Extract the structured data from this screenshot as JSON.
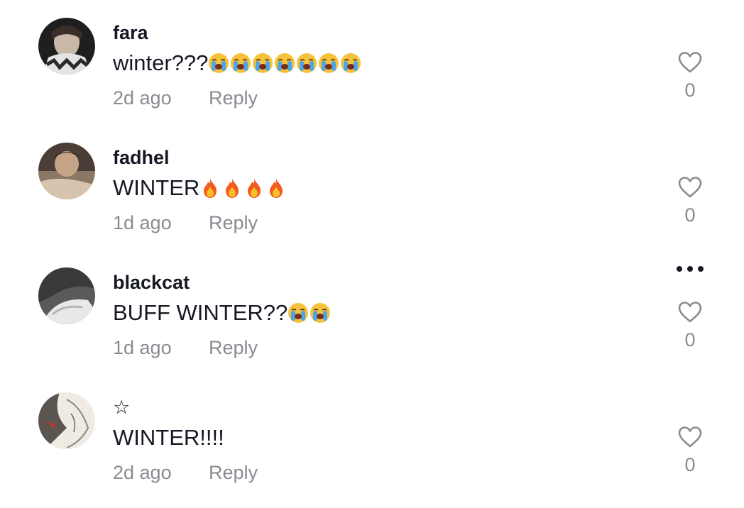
{
  "comments": [
    {
      "username": "fara",
      "text": "winter???",
      "emojis": [
        "loudly-crying-face",
        "loudly-crying-face",
        "loudly-crying-face",
        "loudly-crying-face",
        "loudly-crying-face",
        "loudly-crying-face",
        "loudly-crying-face"
      ],
      "time": "2d ago",
      "reply_label": "Reply",
      "like_count": "0",
      "avatar_colors": [
        "#2b2b2b",
        "#cfcfcf"
      ]
    },
    {
      "username": "fadhel",
      "text": "WINTER",
      "emojis": [
        "fire",
        "fire",
        "fire",
        "fire"
      ],
      "time": "1d ago",
      "reply_label": "Reply",
      "like_count": "0",
      "avatar_colors": [
        "#6b5a4a",
        "#d9c7b5"
      ]
    },
    {
      "username": "blackcat",
      "text": "BUFF WINTER??",
      "emojis": [
        "loudly-crying-face",
        "loudly-crying-face"
      ],
      "time": "1d ago",
      "reply_label": "Reply",
      "like_count": "0",
      "avatar_colors": [
        "#3d3d3d",
        "#e6e6e6"
      ],
      "has_more_menu": true
    },
    {
      "username": "☆",
      "text": "WINTER!!!!",
      "emojis": [],
      "time": "2d ago",
      "reply_label": "Reply",
      "like_count": "0",
      "avatar_colors": [
        "#8c8c8c",
        "#f0eee9"
      ]
    }
  ],
  "icons": {
    "like": "heart-outline-icon",
    "more": "more-horizontal-icon"
  },
  "colors": {
    "text": "#161823",
    "muted": "#8a8b91",
    "heart_stroke": "#8a8b91"
  }
}
